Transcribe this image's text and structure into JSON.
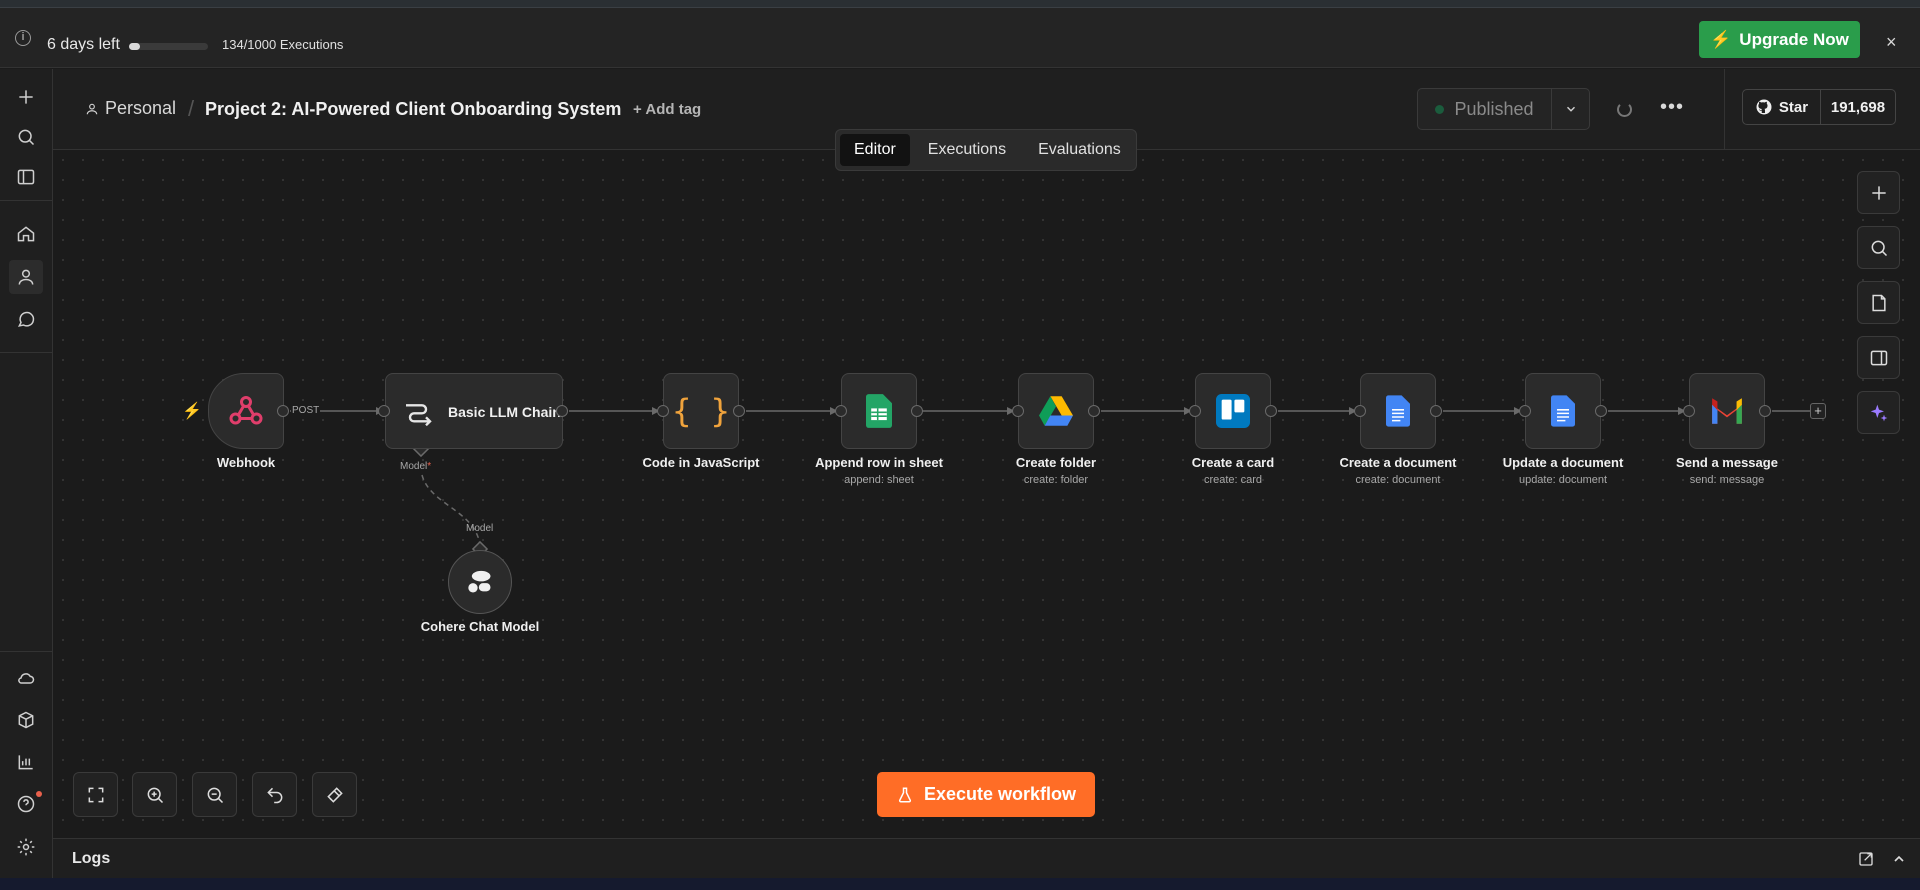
{
  "trial": {
    "days_left": "6 days left",
    "executions": "134/1000 Executions",
    "usage_fraction": 0.134,
    "upgrade_label": "Upgrade Now",
    "close": "×"
  },
  "breadcrumb": {
    "owner": "Personal",
    "title": "Project 2: AI-Powered Client Onboarding System",
    "add_tag": "+ Add tag"
  },
  "tabs": [
    {
      "label": "Editor",
      "active": true
    },
    {
      "label": "Executions",
      "active": false
    },
    {
      "label": "Evaluations",
      "active": false
    }
  ],
  "publish": {
    "label": "Published"
  },
  "github": {
    "star_label": "Star",
    "stars": "191,698"
  },
  "nodes": [
    {
      "label": "Webhook",
      "sub": ""
    },
    {
      "label": "Basic LLM Chain",
      "sub": ""
    },
    {
      "label": "Code in JavaScript",
      "sub": ""
    },
    {
      "label": "Append row in sheet",
      "sub": "append: sheet"
    },
    {
      "label": "Create folder",
      "sub": "create: folder"
    },
    {
      "label": "Create a card",
      "sub": "create: card"
    },
    {
      "label": "Create a document",
      "sub": "create: document"
    },
    {
      "label": "Update a document",
      "sub": "update: document"
    },
    {
      "label": "Send a message",
      "sub": "send: message"
    },
    {
      "label": "Cohere Chat Model",
      "sub": ""
    }
  ],
  "edge_labels": {
    "post": "POST",
    "model_out": "Model",
    "model_required": "*",
    "model_in": "Model"
  },
  "execute_label": "Execute workflow",
  "logs_label": "Logs",
  "colors": {
    "upgrade": "#2a9d4b",
    "execute": "#ff6d26",
    "webhook": "#e03e6b"
  }
}
